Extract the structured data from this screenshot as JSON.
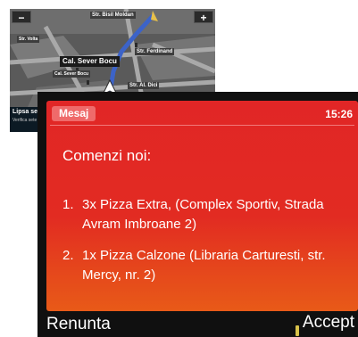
{
  "map": {
    "zoom_out_label": "−",
    "zoom_in_label": "+",
    "streets": [
      "Str. Bisil Moldan",
      "Str. Volta",
      "Str. Ferdinand",
      "Cal. Sever Bocu",
      "Str. Al. Dici"
    ],
    "current_street": "Cal. Sever Bocu",
    "status_title": "Lipsa sem",
    "status_subtitle": "Verifica sete"
  },
  "message": {
    "tag": "Mesaj",
    "time": "15:26",
    "title": "Comenzi noi:",
    "orders": [
      {
        "num": "1.",
        "text": "3x Pizza Extra, (Complex Sportiv, Strada Avram Imbroane 2)"
      },
      {
        "num": "2.",
        "text": "1x Pizza Calzone (Libraria Carturesti, str. Mercy, nr. 2)"
      }
    ]
  },
  "softkeys": {
    "left": "Renunta",
    "right": "Accept"
  },
  "colors": {
    "message_bg": "#e12626",
    "message_bg_bottom": "#e85a18",
    "tag_bg": "#ef6a6a",
    "route": "#3c63c8",
    "map_road": "#a9a9a9"
  }
}
